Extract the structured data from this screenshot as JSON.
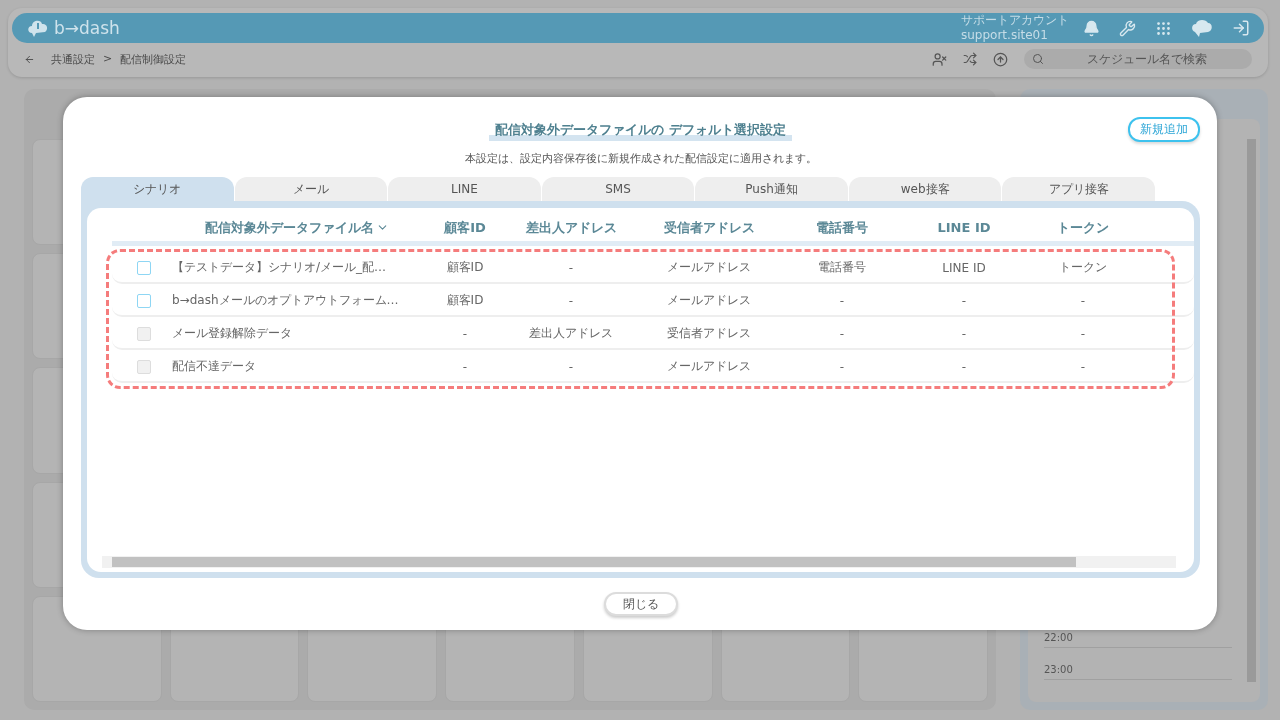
{
  "header": {
    "logo": "b→dash",
    "account_name": "サポートアカウント",
    "account_id": "support.site01"
  },
  "breadcrumb": {
    "items": [
      "共通設定",
      "配信制御設定"
    ],
    "separator": ">"
  },
  "search": {
    "placeholder": "スケジュール名で検索"
  },
  "timeline": {
    "times": [
      "22:00",
      "23:00"
    ]
  },
  "modal": {
    "title": "配信対象外データファイルの デフォルト選択設定",
    "subtitle": "本設定は、設定内容保存後に新規作成された配信設定に適用されます。",
    "add_button": "新規追加",
    "tabs": [
      {
        "label": "シナリオ",
        "selected": true
      },
      {
        "label": "メール",
        "selected": false
      },
      {
        "label": "LINE",
        "selected": false
      },
      {
        "label": "SMS",
        "selected": false
      },
      {
        "label": "Push通知",
        "selected": false
      },
      {
        "label": "web接客",
        "selected": false
      },
      {
        "label": "アプリ接客",
        "selected": false
      }
    ],
    "table": {
      "columns": [
        {
          "label": "配信対象外データファイル名",
          "sorted": true
        },
        {
          "label": "顧客ID",
          "sorted": false
        },
        {
          "label": "差出人アドレス",
          "sorted": false
        },
        {
          "label": "受信者アドレス",
          "sorted": false
        },
        {
          "label": "電話番号",
          "sorted": false
        },
        {
          "label": "LINE ID",
          "sorted": false
        },
        {
          "label": "トークン",
          "sorted": false
        }
      ],
      "rows": [
        {
          "disabled": false,
          "cells": [
            "【テストデータ】シナリオ/メール_配…",
            "顧客ID",
            "-",
            "メールアドレス",
            "電話番号",
            "LINE ID",
            "トークン"
          ]
        },
        {
          "disabled": false,
          "cells": [
            "b→dashメールのオプトアウトフォーム…",
            "顧客ID",
            "-",
            "メールアドレス",
            "-",
            "-",
            "-"
          ]
        },
        {
          "disabled": true,
          "cells": [
            "メール登録解除データ",
            "-",
            "差出人アドレス",
            "受信者アドレス",
            "-",
            "-",
            "-"
          ]
        },
        {
          "disabled": true,
          "cells": [
            "配信不達データ",
            "-",
            "-",
            "メールアドレス",
            "-",
            "-",
            "-"
          ]
        }
      ]
    },
    "close_button": "閉じる"
  }
}
